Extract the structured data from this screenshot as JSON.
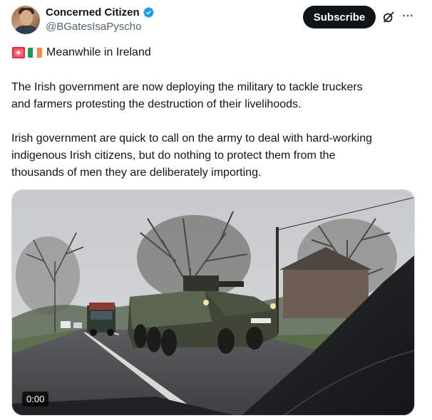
{
  "author": {
    "display_name": "Concerned Citizen",
    "handle": "@BGatesIsaPyscho",
    "verified": true,
    "verified_color": "#1d9bf0"
  },
  "actions": {
    "subscribe_label": "Subscribe",
    "grok_icon": "grok-icon",
    "more_icon": "more-icon"
  },
  "post": {
    "emoji_line": "Meanwhile in Ireland",
    "paragraph_1": "The Irish government are now deploying the military to tackle truckers\nand farmers protesting the destruction of their livelihoods.",
    "paragraph_2": "Irish government are quick to call on the army to deal with hard-working\nindigenous Irish citizens, but do nothing to protect them from the\nthousands of men they are deliberately importing."
  },
  "video": {
    "timestamp": "0:00"
  }
}
